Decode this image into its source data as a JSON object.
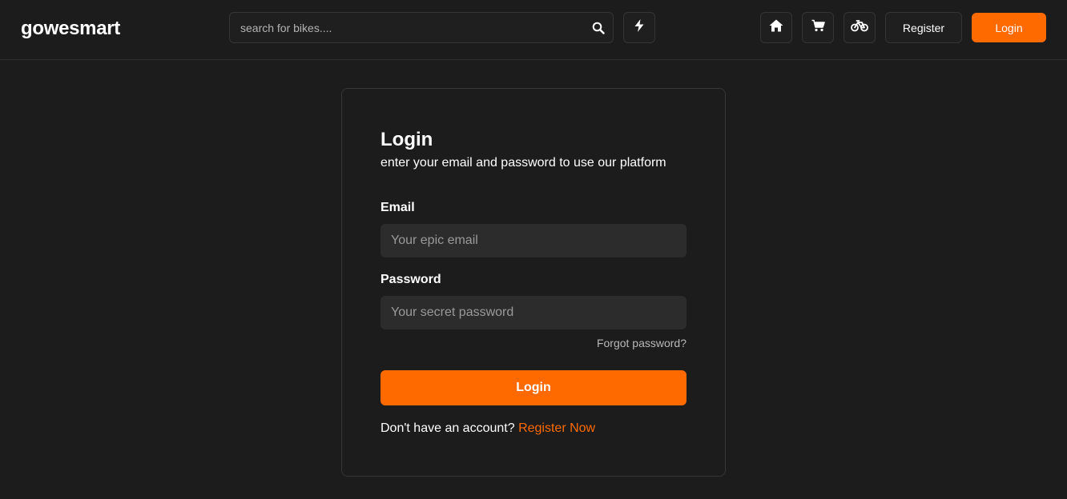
{
  "header": {
    "brand": "gowesmart",
    "search": {
      "placeholder": "search for bikes....",
      "icon": "search-icon"
    },
    "icons": [
      "flash-icon",
      "home-icon",
      "cart-icon",
      "bike-icon"
    ],
    "register_label": "Register",
    "login_label": "Login"
  },
  "login_card": {
    "title": "Login",
    "subtitle": "enter your email and password to use our platform",
    "email": {
      "label": "Email",
      "placeholder": "Your epic email",
      "value": ""
    },
    "password": {
      "label": "Password",
      "placeholder": "Your secret password",
      "value": ""
    },
    "forgot_label": "Forgot password?",
    "submit_label": "Login",
    "no_account_text": "Don't have an account?",
    "register_link_label": "Register Now"
  },
  "colors": {
    "background": "#1c1c1c",
    "accent": "#ff6a00",
    "input_bg": "#2c2c2c",
    "border": "#353535"
  }
}
